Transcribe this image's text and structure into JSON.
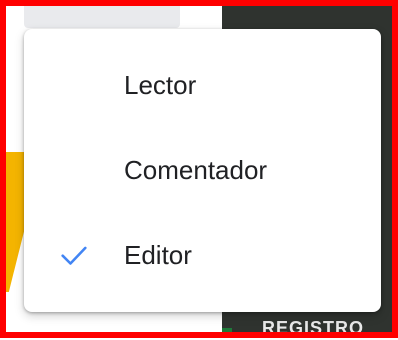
{
  "menu": {
    "items": [
      {
        "label": "Lector",
        "selected": false
      },
      {
        "label": "Comentador",
        "selected": false
      },
      {
        "label": "Editor",
        "selected": true
      }
    ],
    "check_icon": "check-icon",
    "check_color": "#4285f4"
  },
  "background": {
    "bottom_text": "REGISTRO"
  }
}
